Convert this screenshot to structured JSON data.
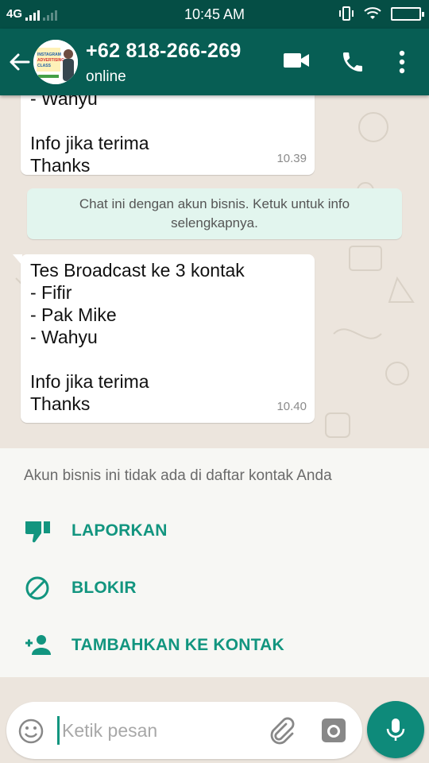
{
  "status_bar": {
    "network": "4G",
    "time": "10:45 AM"
  },
  "header": {
    "contact_name": "+62 818-266-269",
    "status": "online",
    "avatar_text": [
      "INSTAGRAM",
      "ADVERTISING",
      "CLASS"
    ]
  },
  "messages": [
    {
      "lines": [
        "- Wahyu",
        "",
        "Info jika terima",
        "Thanks"
      ],
      "time": "10.39"
    },
    {
      "lines": [
        "Tes Broadcast ke 3 kontak",
        "- Fifir",
        "- Pak Mike",
        "- Wahyu",
        "",
        "Info jika terima",
        "Thanks"
      ],
      "time": "10.40"
    }
  ],
  "system_message": "Chat ini dengan akun bisnis. Ketuk untuk info selengkapnya.",
  "business_panel": {
    "note": "Akun bisnis ini tidak ada di daftar kontak Anda",
    "report_label": "LAPORKAN",
    "block_label": "BLOKIR",
    "add_contact_label": "TAMBAHKAN KE KONTAK"
  },
  "composer": {
    "placeholder": "Ketik pesan"
  },
  "colors": {
    "header": "#075e54",
    "status_bar": "#054e45",
    "accent": "#12957f",
    "system_bubble": "#e2f5ee"
  },
  "icons": [
    "back-arrow-icon",
    "video-call-icon",
    "phone-icon",
    "more-vert-icon",
    "thumb-down-icon",
    "block-icon",
    "add-person-icon",
    "emoji-icon",
    "attach-icon",
    "camera-icon",
    "mic-icon"
  ]
}
